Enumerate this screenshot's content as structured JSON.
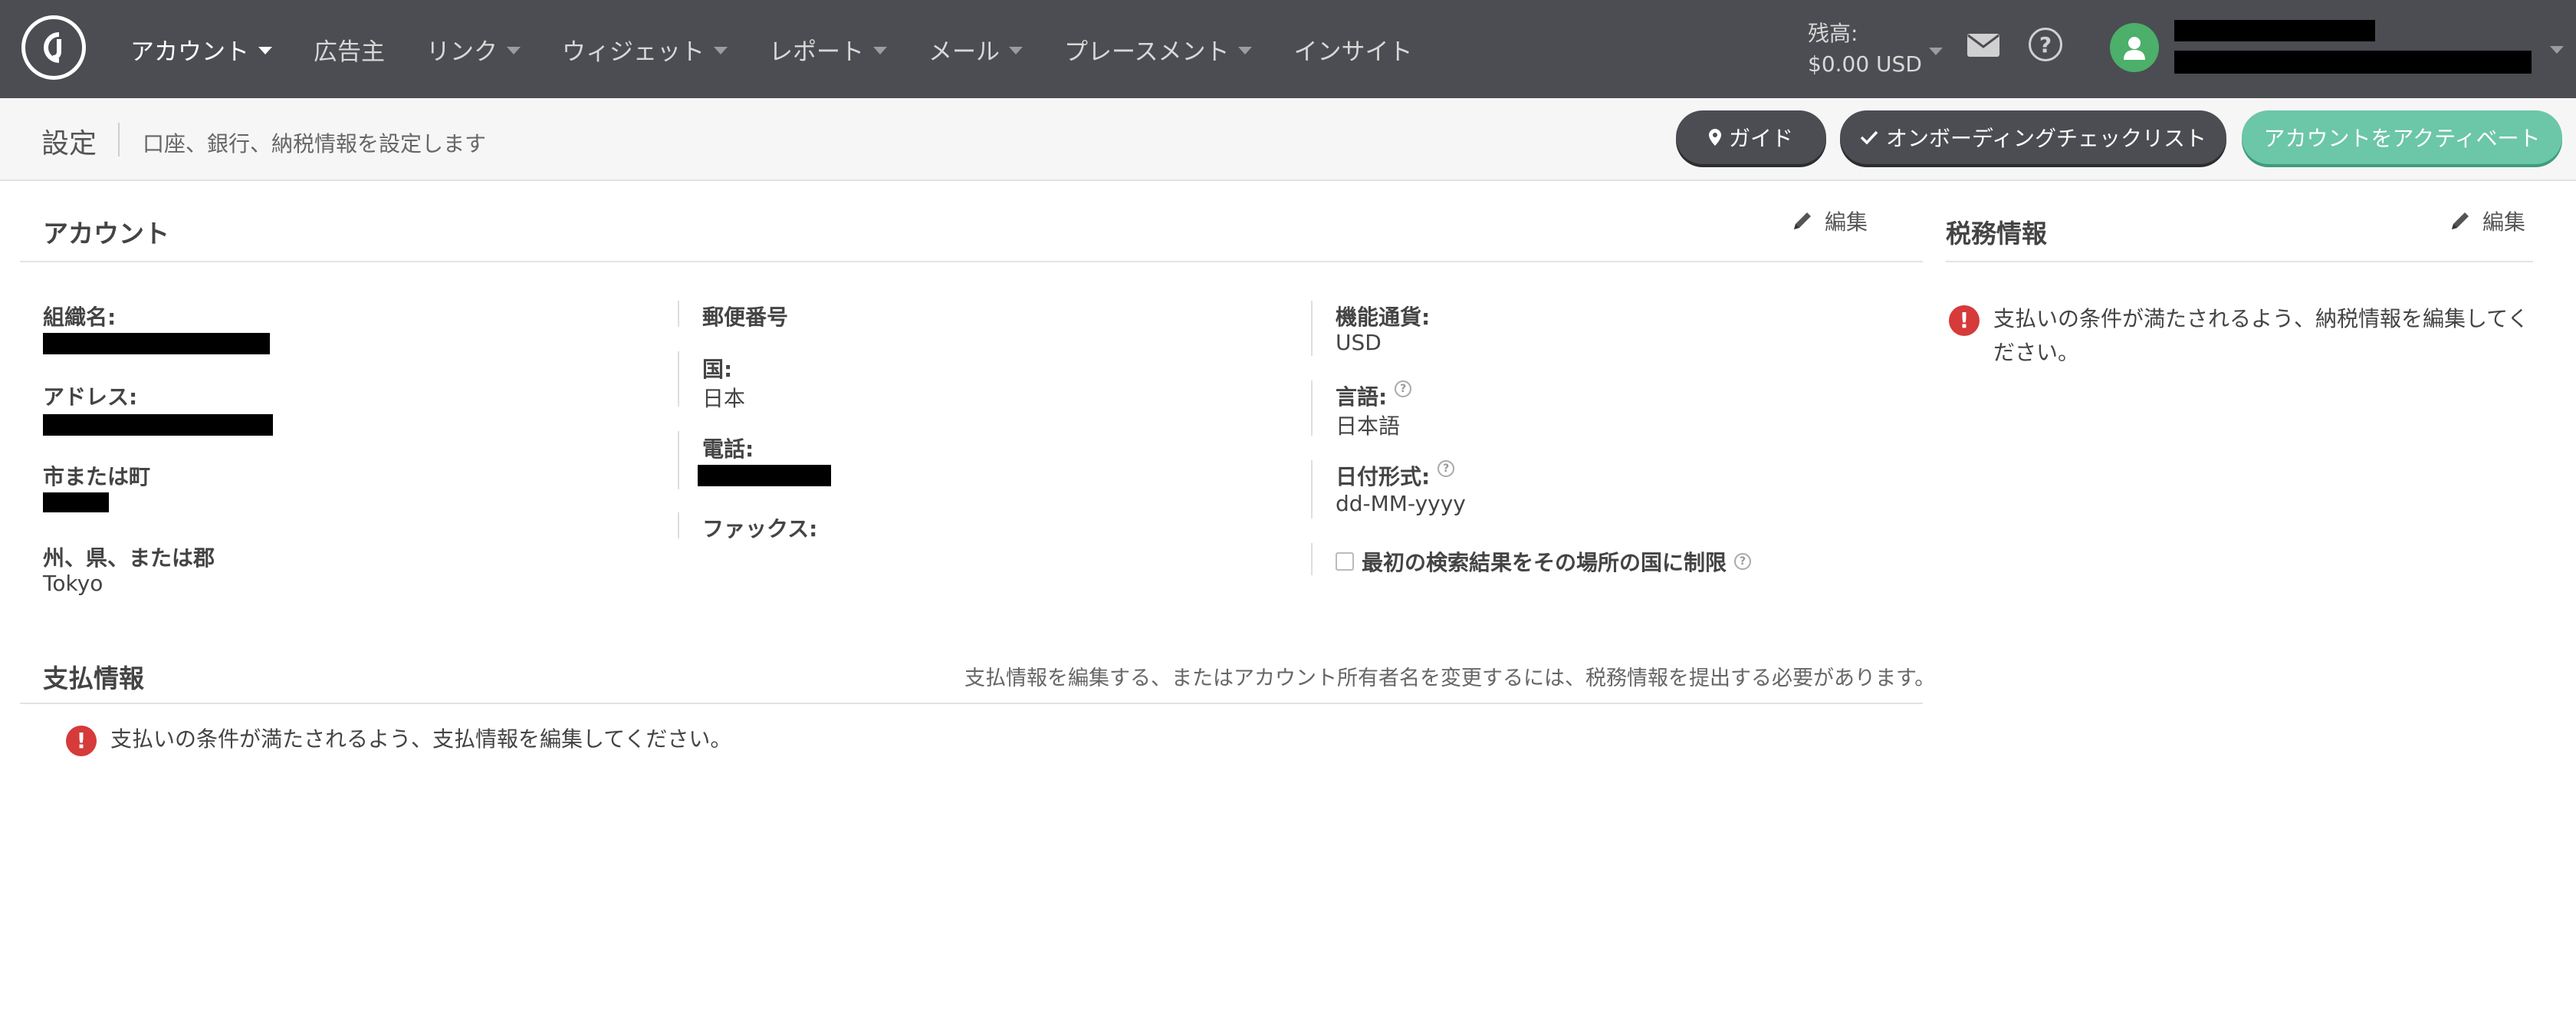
{
  "nav": {
    "items": [
      {
        "label": "アカウント",
        "has_caret": true,
        "active": true
      },
      {
        "label": "広告主",
        "has_caret": false,
        "active": false
      },
      {
        "label": "リンク",
        "has_caret": true,
        "active": false
      },
      {
        "label": "ウィジェット",
        "has_caret": true,
        "active": false
      },
      {
        "label": "レポート",
        "has_caret": true,
        "active": false
      },
      {
        "label": "メール",
        "has_caret": true,
        "active": false
      },
      {
        "label": "プレースメント",
        "has_caret": true,
        "active": false
      },
      {
        "label": "インサイト",
        "has_caret": false,
        "active": false
      }
    ],
    "balance_label": "残高:",
    "balance_value": "$0.00 USD",
    "help_glyph": "?"
  },
  "subheader": {
    "title": "設定",
    "subtitle": "口座、銀行、納税情報を設定します",
    "guide_label": "ガイド",
    "checklist_label": "オンボーディングチェックリスト",
    "activate_label": "アカウントをアクティベート"
  },
  "account": {
    "title": "アカウント",
    "edit_label": "編集",
    "col1": {
      "org_label": "組織名:",
      "address_label": "アドレス:",
      "city_label": "市または町",
      "state_label": "州、県、または郡",
      "state_value": "Tokyo"
    },
    "col2": {
      "postal_label": "郵便番号",
      "country_label": "国:",
      "country_value": "日本",
      "phone_label": "電話:",
      "fax_label": "ファックス:"
    },
    "col3": {
      "currency_label": "機能通貨:",
      "currency_value": "USD",
      "language_label": "言語:",
      "language_value": "日本語",
      "date_format_label": "日付形式:",
      "date_format_value": "dd-MM-yyyy",
      "restrict_label": "最初の検索結果をその場所の国に制限",
      "restrict_checked": false
    }
  },
  "tax": {
    "title": "税務情報",
    "edit_label": "編集",
    "alert_text": "支払いの条件が満たされるよう、納税情報を編集してください。"
  },
  "payment": {
    "title": "支払情報",
    "note": "支払情報を編集する、またはアカウント所有者名を変更するには、税務情報を提出する必要があります。",
    "alert_text": "支払いの条件が満たされるよう、支払情報を編集してください。"
  },
  "colors": {
    "topbar": "#4b4d52",
    "accent_green": "#6cc6a8",
    "alert_red": "#d63a3a",
    "avatar_green": "#4caf6a"
  },
  "icons": {
    "logo": "cj-logo-icon",
    "mail": "mail-icon",
    "help": "help-circle-icon",
    "user": "user-icon",
    "guide": "map-pin-icon",
    "checklist": "check-icon",
    "edit": "pencil-icon",
    "alert": "exclamation-circle-icon",
    "info": "question-dot-icon"
  }
}
